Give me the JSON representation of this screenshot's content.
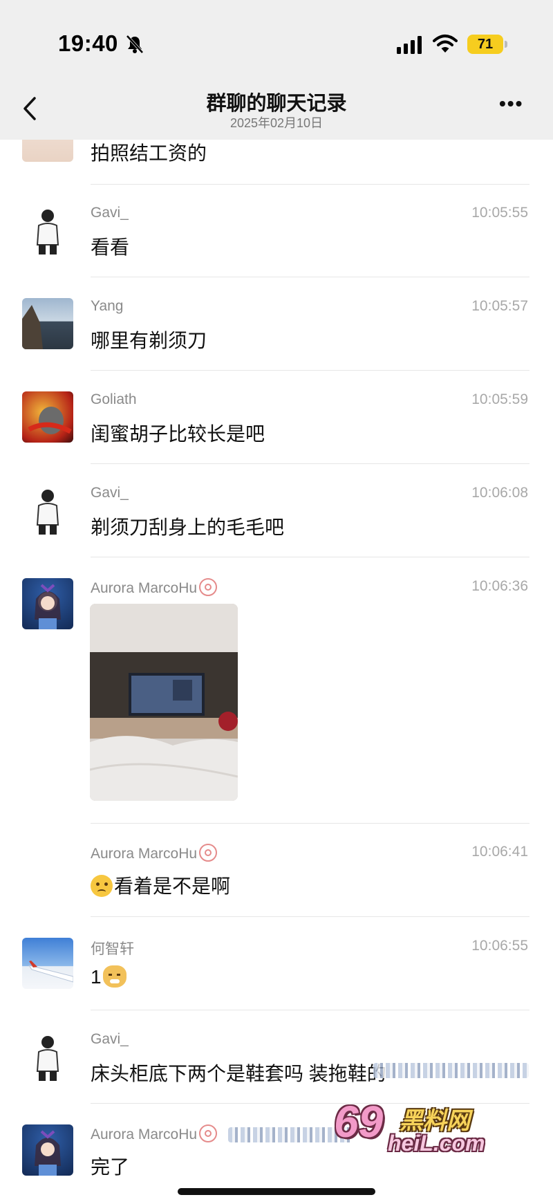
{
  "status_bar": {
    "time": "19:40",
    "battery": "71"
  },
  "header": {
    "title": "群聊的聊天记录",
    "subtitle": "2025年02月10日"
  },
  "messages": [
    {
      "name": "",
      "time": "",
      "text": "拍照结工资的"
    },
    {
      "name": "Gavi_",
      "time": "10:05:55",
      "text": "看看"
    },
    {
      "name": "Yang",
      "time": "10:05:57",
      "text": "哪里有剃须刀"
    },
    {
      "name": "Goliath",
      "time": "10:05:59",
      "text": "闺蜜胡子比较长是吧"
    },
    {
      "name": "Gavi_",
      "time": "10:06:08",
      "text": "剃须刀刮身上的毛毛吧"
    },
    {
      "name": "Aurora MarcoHu",
      "time": "10:06:36",
      "text": ""
    },
    {
      "name": "Aurora MarcoHu",
      "time": "10:06:41",
      "text": "看着是不是啊"
    },
    {
      "name": "何智轩",
      "time": "10:06:55",
      "text": "1"
    },
    {
      "name": "Gavi_",
      "time": "",
      "text": "床头柜底下两个是鞋套吗 装拖鞋的"
    },
    {
      "name": "Aurora MarcoHu",
      "time": "",
      "text": "完了"
    }
  ],
  "watermark": {
    "number": "69",
    "brand": "黑料网",
    "url": "heiL.com"
  },
  "icons": [
    "bell-slash-icon",
    "signal-icon",
    "wifi-icon",
    "back-chevron-icon",
    "more-icon"
  ]
}
